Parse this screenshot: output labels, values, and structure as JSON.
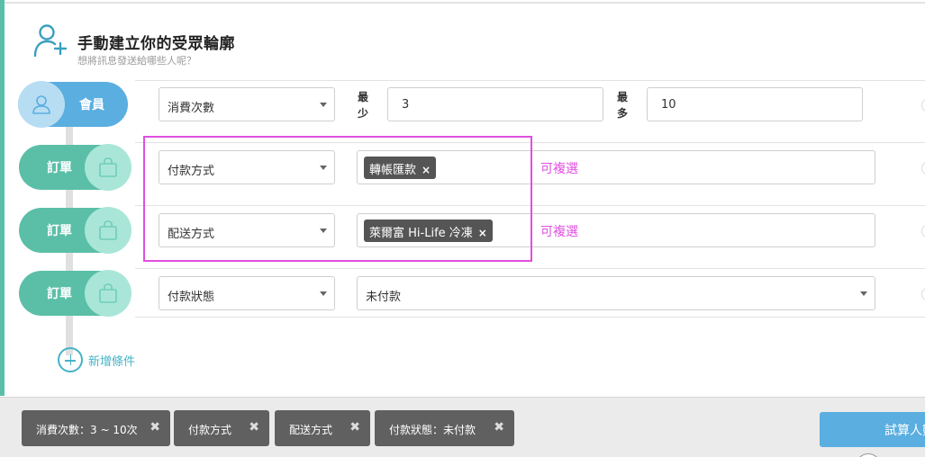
{
  "header": {
    "title": "手動建立你的受眾輪廓",
    "subtitle": "想將訊息發送給哪些人呢？"
  },
  "rows": [
    {
      "type_label": "會員",
      "field": "消費次數",
      "min_label": "最少",
      "min_value": "3",
      "max_label": "最多",
      "max_value": "10"
    },
    {
      "type_label": "訂單",
      "field": "付款方式",
      "tag": "轉帳匯款",
      "hint": "可複選"
    },
    {
      "type_label": "訂單",
      "field": "配送方式",
      "tag": "萊爾富 Hi-Life 冷凍",
      "hint": "可複選"
    },
    {
      "type_label": "訂單",
      "field": "付款狀態",
      "value": "未付款"
    }
  ],
  "add_condition": "新增條件",
  "footer": {
    "chips": [
      "消費次數：3 ~ 10次",
      "付款方式",
      "配送方式",
      "付款狀態：未付款"
    ],
    "calc_button": "試算人數"
  },
  "icons": {
    "header": "add-user-icon",
    "member": "user-icon",
    "order": "shopping-bag-icon",
    "remove": "close-icon",
    "dropdown": "chevron-down-icon"
  },
  "colors": {
    "member": "#5aaee0",
    "order": "#5bbfa8",
    "highlight": "#e04fe0",
    "add": "#45b3c8"
  }
}
